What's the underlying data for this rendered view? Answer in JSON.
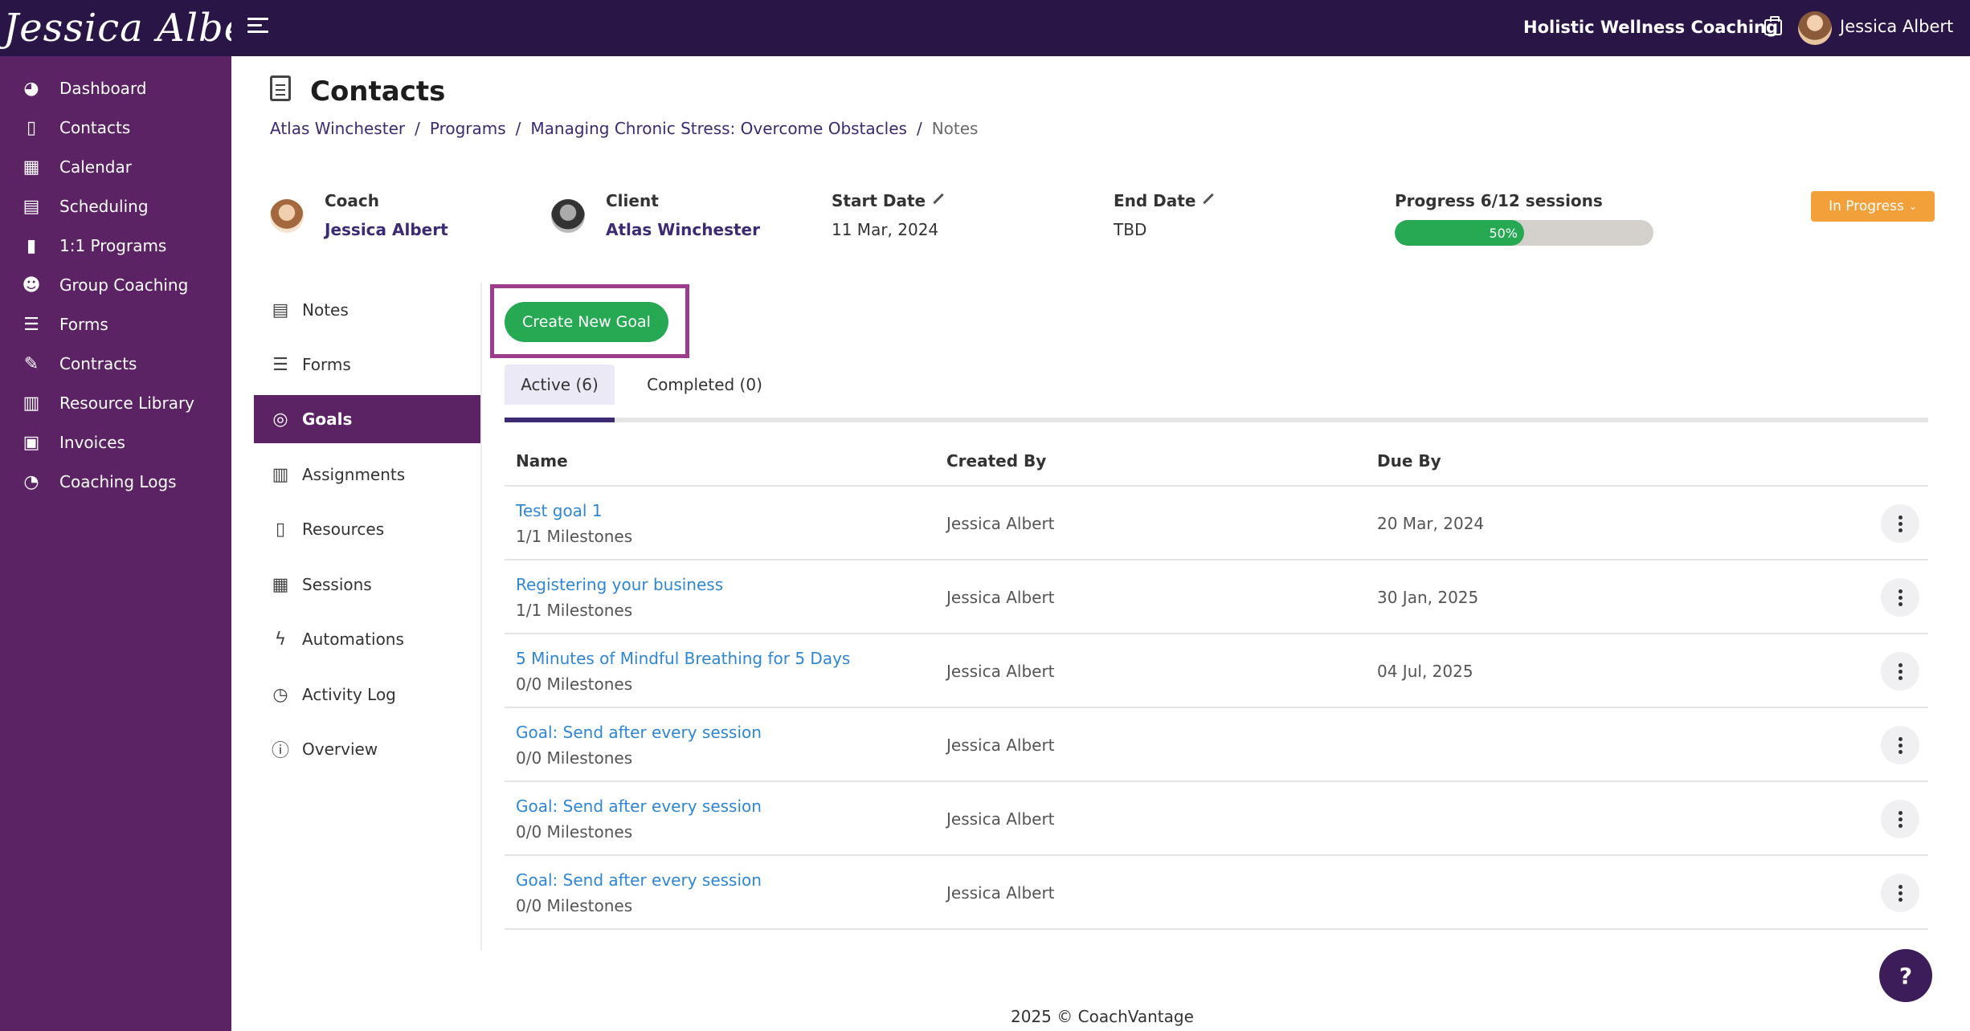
{
  "topbar": {
    "logo_text": "Jessica Albert",
    "org_name": "Holistic Wellness Coaching",
    "user_name": "Jessica Albert"
  },
  "sidebar": {
    "items": [
      {
        "label": "Dashboard",
        "icon": "dashboard-icon"
      },
      {
        "label": "Contacts",
        "icon": "contacts-icon"
      },
      {
        "label": "Calendar",
        "icon": "calendar-icon"
      },
      {
        "label": "Scheduling",
        "icon": "scheduling-icon"
      },
      {
        "label": "1:1 Programs",
        "icon": "book-icon"
      },
      {
        "label": "Group Coaching",
        "icon": "group-icon"
      },
      {
        "label": "Forms",
        "icon": "forms-icon"
      },
      {
        "label": "Contracts",
        "icon": "contract-icon"
      },
      {
        "label": "Resource Library",
        "icon": "library-icon"
      },
      {
        "label": "Invoices",
        "icon": "invoice-icon"
      },
      {
        "label": "Coaching Logs",
        "icon": "clock-icon"
      }
    ]
  },
  "page": {
    "title": "Contacts",
    "breadcrumb": [
      "Atlas Winchester",
      "Programs",
      "Managing Chronic Stress: Overcome Obstacles",
      "Notes"
    ],
    "breadcrumb_sep": "/"
  },
  "info": {
    "coach_label": "Coach",
    "coach_name": "Jessica Albert",
    "client_label": "Client",
    "client_name": "Atlas Winchester",
    "start_label": "Start Date",
    "start_value": "11 Mar, 2024",
    "end_label": "End Date",
    "end_value": "TBD",
    "progress_label": "Progress 6/12 sessions",
    "progress_text": "50%",
    "progress_fraction": 0.5,
    "status": "In Progress"
  },
  "subnav": {
    "items": [
      {
        "label": "Notes",
        "icon": "notes-icon"
      },
      {
        "label": "Forms",
        "icon": "forms-checklist-icon"
      },
      {
        "label": "Goals",
        "icon": "target-icon",
        "active": true
      },
      {
        "label": "Assignments",
        "icon": "clipboard-icon"
      },
      {
        "label": "Resources",
        "icon": "resources-icon"
      },
      {
        "label": "Sessions",
        "icon": "sessions-calendar-icon"
      },
      {
        "label": "Automations",
        "icon": "lightning-icon"
      },
      {
        "label": "Activity Log",
        "icon": "activity-icon"
      },
      {
        "label": "Overview",
        "icon": "info-icon"
      }
    ]
  },
  "goals": {
    "create_label": "Create New Goal",
    "tabs": [
      "Active (6)",
      "Completed (0)"
    ],
    "columns": [
      "Name",
      "Created By",
      "Due By"
    ],
    "rows": [
      {
        "name": "Test goal 1",
        "milestones": "1/1 Milestones",
        "created_by": "Jessica Albert",
        "due_by": "20 Mar, 2024"
      },
      {
        "name": "Registering your business",
        "milestones": "1/1 Milestones",
        "created_by": "Jessica Albert",
        "due_by": "30 Jan, 2025"
      },
      {
        "name": "5 Minutes of Mindful Breathing for 5 Days",
        "milestones": "0/0 Milestones",
        "created_by": "Jessica Albert",
        "due_by": "04 Jul, 2025"
      },
      {
        "name": "Goal: Send after every session",
        "milestones": "0/0 Milestones",
        "created_by": "Jessica Albert",
        "due_by": ""
      },
      {
        "name": "Goal: Send after every session",
        "milestones": "0/0 Milestones",
        "created_by": "Jessica Albert",
        "due_by": ""
      },
      {
        "name": "Goal: Send after every session",
        "milestones": "0/0 Milestones",
        "created_by": "Jessica Albert",
        "due_by": ""
      }
    ]
  },
  "help_label": "?",
  "footer": "2025 © CoachVantage",
  "colors": {
    "topbar": "#2a1547",
    "sidebar": "#5b2364",
    "accent_green": "#27a953",
    "status_orange": "#f2a13a",
    "link_blue": "#2f86d4",
    "highlight": "#9b3d8c"
  }
}
